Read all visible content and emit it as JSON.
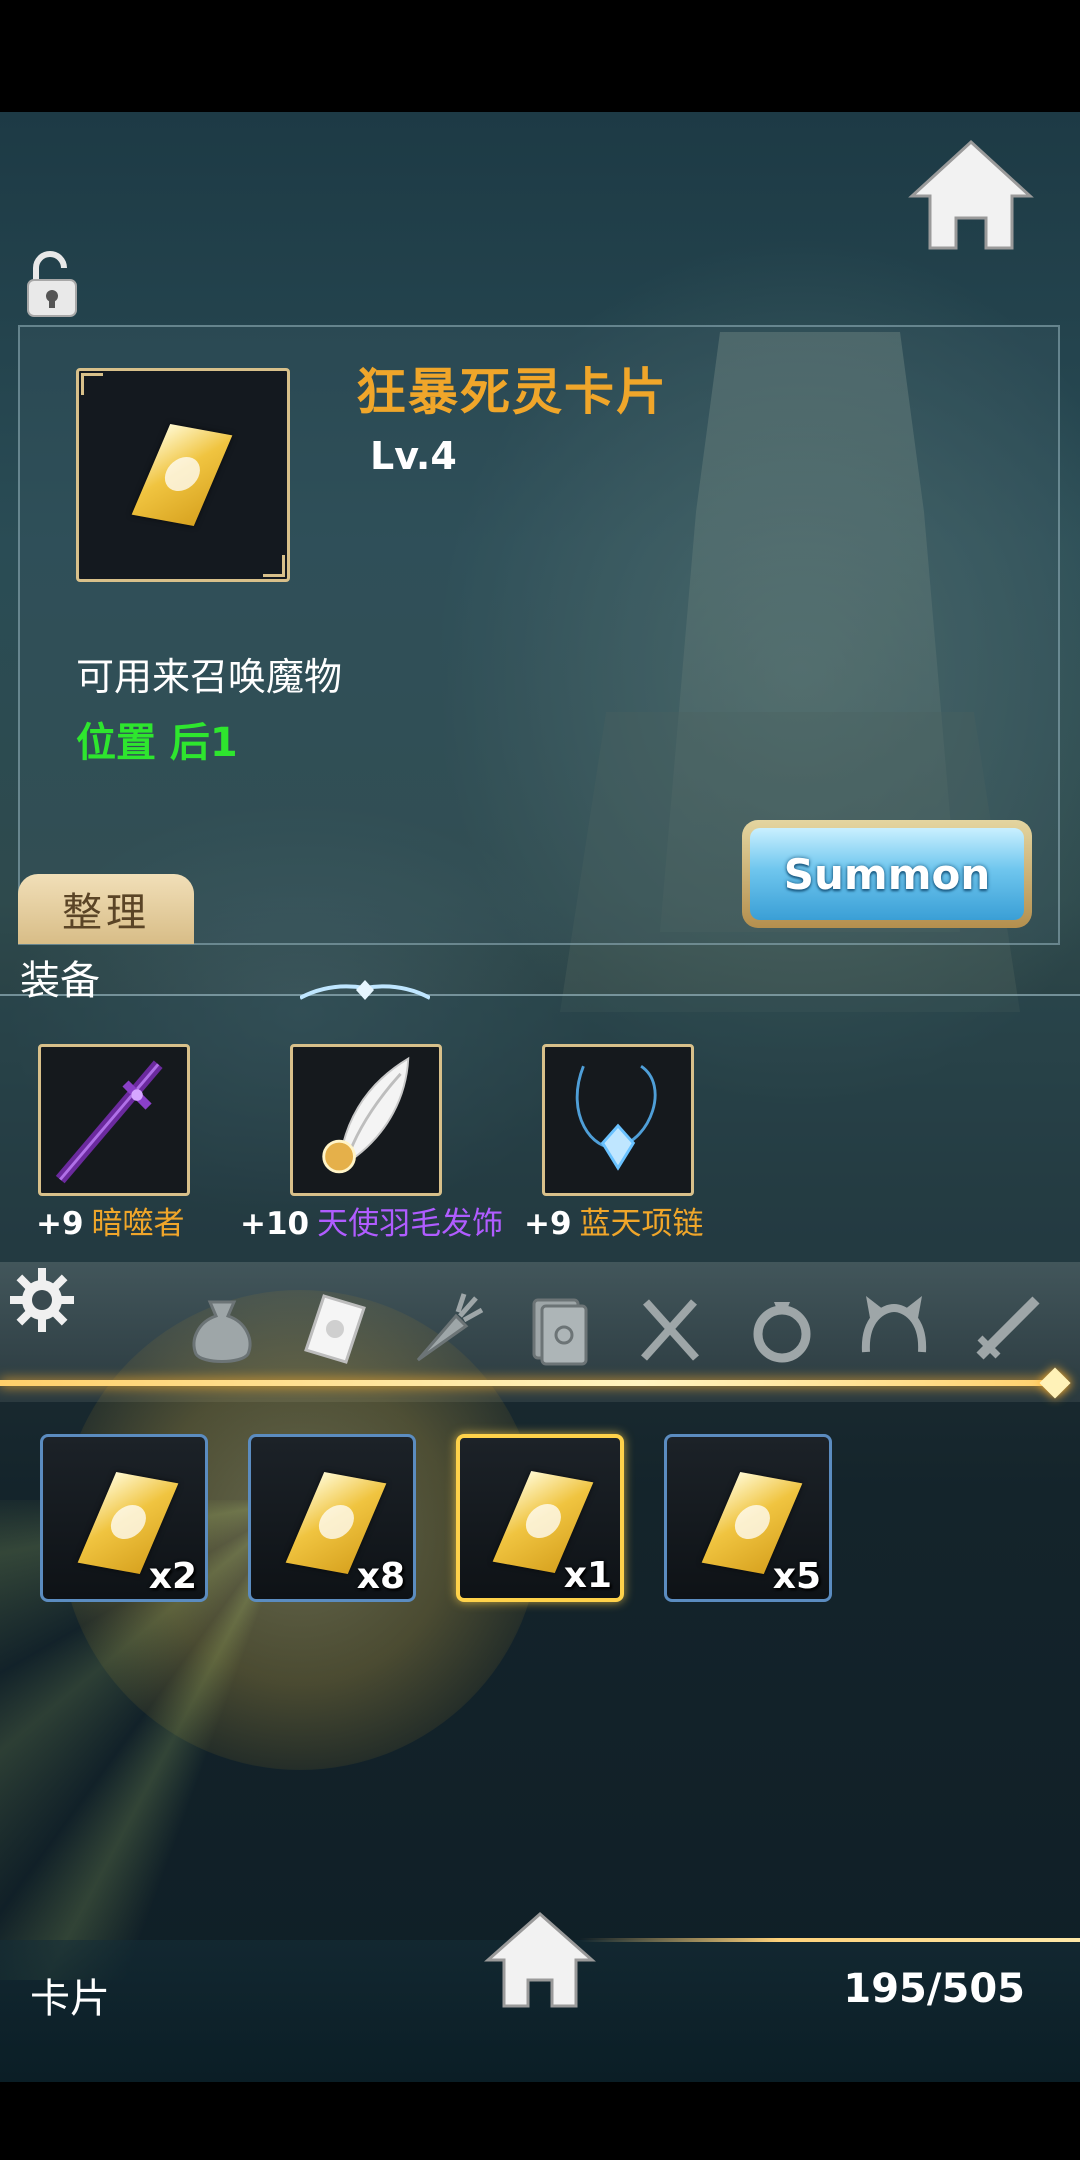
{
  "item": {
    "name": "狂暴死灵卡片",
    "level": "Lv.4",
    "description": "可用来召唤魔物",
    "position": "位置 后1"
  },
  "buttons": {
    "summon": "Summon",
    "sort": "整理"
  },
  "equipment": {
    "section_label": "装备",
    "items": [
      {
        "enhance": "+9",
        "name": "暗噬者",
        "name_color": "#f0a62a",
        "icon": "dark-sword-icon"
      },
      {
        "enhance": "+10",
        "name": "天使羽毛发饰",
        "name_color": "#b05cff",
        "icon": "angel-feather-icon"
      },
      {
        "enhance": "+9",
        "name": "蓝天项链",
        "name_color": "#f0a62a",
        "icon": "blue-necklace-icon"
      }
    ]
  },
  "category_tabs": [
    {
      "name": "loot-bag",
      "active": false
    },
    {
      "name": "card",
      "active": true
    },
    {
      "name": "carrot",
      "active": false
    },
    {
      "name": "book",
      "active": false
    },
    {
      "name": "utensils",
      "active": false
    },
    {
      "name": "ring",
      "active": false
    },
    {
      "name": "headband",
      "active": false
    },
    {
      "name": "sword",
      "active": false
    }
  ],
  "inventory": [
    {
      "count": "x2",
      "selected": false
    },
    {
      "count": "x8",
      "selected": false
    },
    {
      "count": "x1",
      "selected": true
    },
    {
      "count": "x5",
      "selected": false
    }
  ],
  "footer": {
    "category": "卡片",
    "capacity": "195/505"
  },
  "colors": {
    "accent_gold": "#f0a62a",
    "position_green": "#2ee62e",
    "slot_border": "#5b8cc0",
    "selected_border": "#ffd24a"
  }
}
